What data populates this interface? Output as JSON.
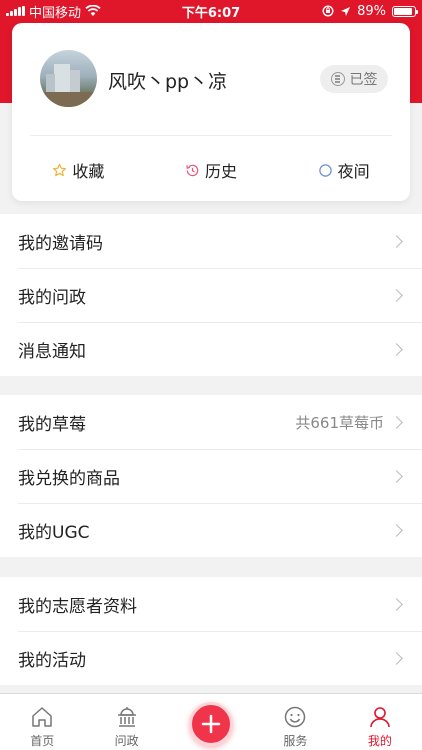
{
  "status_bar": {
    "carrier": "中国移动",
    "time": "下午6:07",
    "battery": "89%",
    "battery_level": 0.89
  },
  "profile": {
    "username": "风吹丶pp丶凉",
    "checkin_label": "已签"
  },
  "quick_actions": [
    {
      "label": "收藏",
      "icon": "star-icon"
    },
    {
      "label": "历史",
      "icon": "clock-icon"
    },
    {
      "label": "夜间",
      "icon": "moon-icon"
    }
  ],
  "menu_groups": [
    {
      "items": [
        {
          "label": "我的邀请码"
        },
        {
          "label": "我的问政"
        },
        {
          "label": "消息通知"
        }
      ]
    },
    {
      "items": [
        {
          "label": "我的草莓",
          "value": "共661草莓币"
        },
        {
          "label": "我兑换的商品"
        },
        {
          "label": "我的UGC"
        }
      ]
    },
    {
      "items": [
        {
          "label": "我的志愿者资料"
        },
        {
          "label": "我的活动"
        }
      ]
    }
  ],
  "tab_bar": {
    "tabs": [
      {
        "label": "首页",
        "icon": "home-icon"
      },
      {
        "label": "问政",
        "icon": "government-building-icon"
      },
      {
        "label": "",
        "icon": "plus-icon"
      },
      {
        "label": "服务",
        "icon": "smiley-icon"
      },
      {
        "label": "我的",
        "icon": "person-icon"
      }
    ],
    "active_index": 4
  },
  "colors": {
    "brand_red": "#e0162b",
    "publish_button": "#f0354a",
    "star_yellow": "#f0b43a",
    "clock_pink": "#e8577a",
    "moon_blue": "#6a8fd8"
  }
}
